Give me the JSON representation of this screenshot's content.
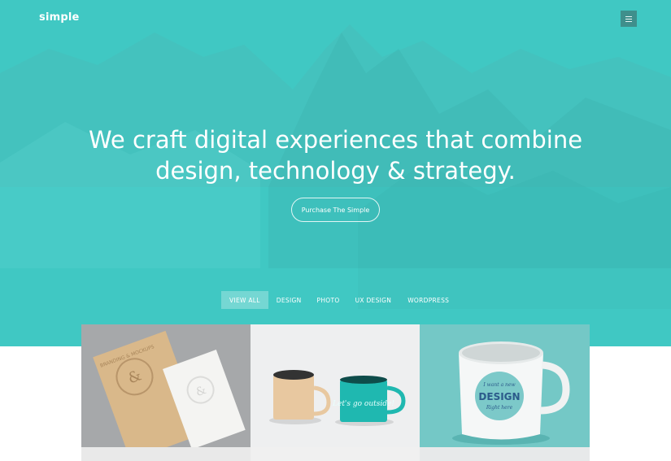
{
  "brand": {
    "logo_text": "simple"
  },
  "header": {
    "menu_icon": "hamburger-menu-icon"
  },
  "hero": {
    "headline_line1": "We craft digital experiences that combine",
    "headline_line2": "design, technology & strategy.",
    "cta_label": "Purchase The Simple",
    "accent_color": "#40c8c3"
  },
  "filters": {
    "items": [
      "VIEW ALL",
      "DESIGN",
      "PHOTO",
      "UX DESIGN",
      "WORDPRESS"
    ],
    "active": "VIEW ALL"
  },
  "portfolio": {
    "tiles": [
      {
        "subject": "branding mockup business cards",
        "emboss_text": "BRANDING & MOCKUPS"
      },
      {
        "subject": "enamel camping mugs",
        "mug_text": "Let's go outside!"
      },
      {
        "subject": "white coffee mug",
        "mug_text_1": "I want a new",
        "mug_text_2": "DESIGN",
        "mug_text_3": "Right here"
      }
    ]
  }
}
